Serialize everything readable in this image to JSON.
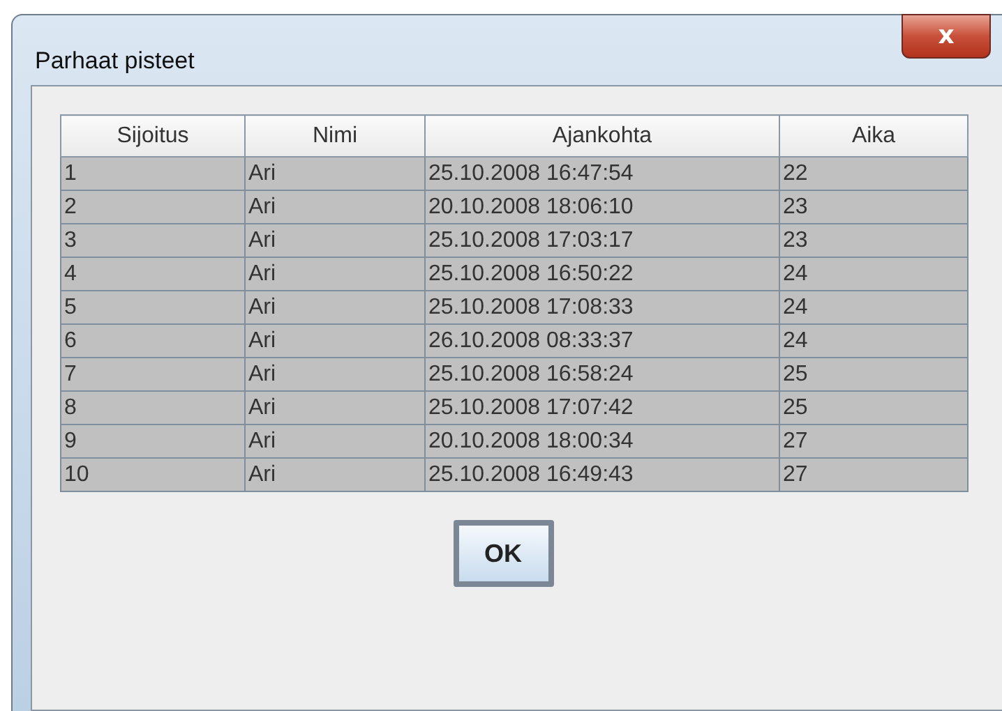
{
  "window": {
    "title": "Parhaat pisteet",
    "close_label": "x"
  },
  "table": {
    "columns": [
      "Sijoitus",
      "Nimi",
      "Ajankohta",
      "Aika"
    ],
    "rows": [
      {
        "cells": [
          "1",
          "Ari",
          "25.10.2008 16:47:54",
          "22"
        ],
        "selected": true
      },
      {
        "cells": [
          "2",
          "Ari",
          "20.10.2008 18:06:10",
          "23"
        ],
        "selected": true
      },
      {
        "cells": [
          "3",
          "Ari",
          "25.10.2008 17:03:17",
          "23"
        ],
        "selected": true
      },
      {
        "cells": [
          "4",
          "Ari",
          "25.10.2008 16:50:22",
          "24"
        ],
        "selected": true
      },
      {
        "cells": [
          "5",
          "Ari",
          "25.10.2008 17:08:33",
          "24"
        ],
        "selected": true
      },
      {
        "cells": [
          "6",
          "Ari",
          "26.10.2008 08:33:37",
          "24"
        ],
        "selected": true
      },
      {
        "cells": [
          "7",
          "Ari",
          "25.10.2008 16:58:24",
          "25"
        ],
        "selected": true
      },
      {
        "cells": [
          "8",
          "Ari",
          "25.10.2008 17:07:42",
          "25"
        ],
        "selected": true
      },
      {
        "cells": [
          "9",
          "Ari",
          "20.10.2008 18:00:34",
          "27"
        ],
        "selected": true
      },
      {
        "cells": [
          "10",
          "Ari",
          "25.10.2008 16:49:43",
          "27"
        ],
        "selected": true
      }
    ]
  },
  "buttons": [
    "OK"
  ]
}
